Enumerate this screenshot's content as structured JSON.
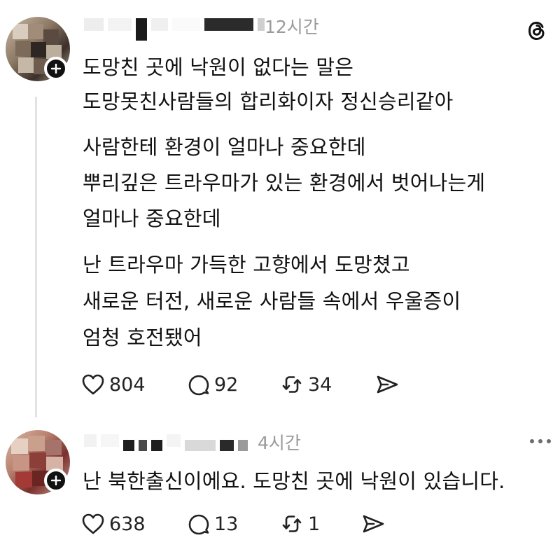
{
  "posts": [
    {
      "time": "12시간",
      "paragraphs": [
        [
          "도망친 곳에 낙원이 없다는 말은",
          "도망못친사람들의 합리화이자 정신승리같아"
        ],
        [
          "사람한테 환경이 얼마나 중요한데",
          "뿌리깊은 트라우마가 있는 환경에서 벗어나는게",
          "얼마나 중요한데"
        ],
        [
          "난 트라우마 가득한 고향에서 도망쳤고",
          "새로운 터전, 새로운 사람들 속에서 우울증이",
          "엄청 호전됐어"
        ]
      ],
      "likes": "804",
      "comments": "92",
      "reposts": "34"
    },
    {
      "time": "4시간",
      "paragraphs": [
        [
          "난 북한출신이에요. 도망친 곳에 낙원이 있습니다."
        ]
      ],
      "likes": "638",
      "comments": "13",
      "reposts": "1"
    }
  ],
  "icons": {
    "app_logo": "threads-logo-icon",
    "more": "more-options-icon",
    "like": "heart-icon",
    "comment": "comment-icon",
    "repost": "repost-icon",
    "share": "share-icon"
  }
}
